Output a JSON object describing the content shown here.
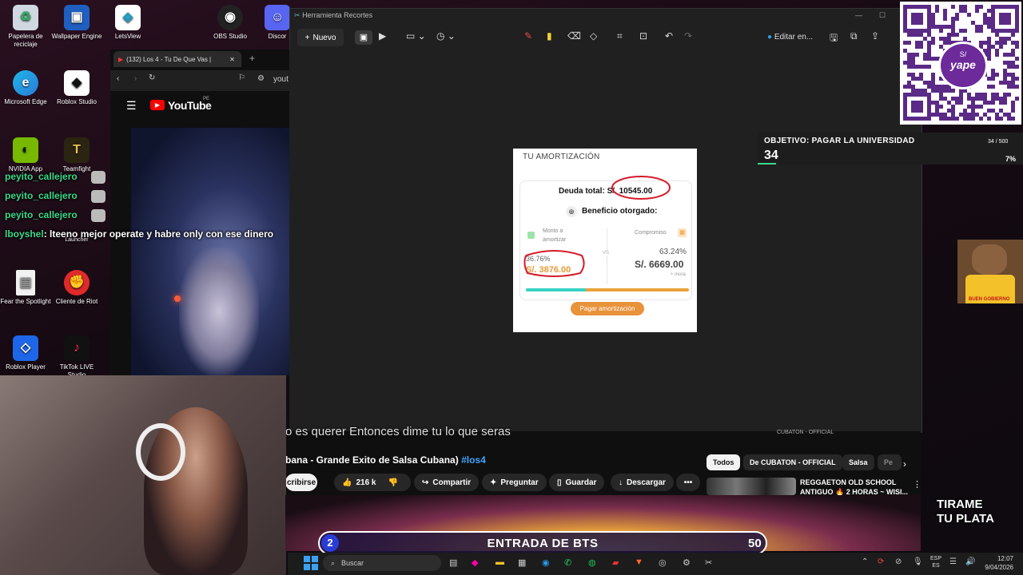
{
  "desktop": {
    "icons": [
      {
        "label": "Papelera de reciclaje",
        "icon": "recycle-bin-icon"
      },
      {
        "label": "Wallpaper Engine",
        "icon": "wallpaper-engine-icon"
      },
      {
        "label": "LetsView",
        "icon": "letsview-icon"
      },
      {
        "label": "OBS Studio",
        "icon": "obs-icon"
      },
      {
        "label": "Discor",
        "icon": "discord-icon"
      },
      {
        "label": "Microsoft Edge",
        "icon": "edge-icon"
      },
      {
        "label": "Roblox Studio",
        "icon": "roblox-studio-icon"
      },
      {
        "label": "NVIDIA App",
        "icon": "nvidia-icon"
      },
      {
        "label": "Teamfight",
        "icon": "teamfight-icon"
      },
      {
        "label": "Launcher",
        "icon": "launcher-icon"
      },
      {
        "label": "Fear the Spotlight",
        "icon": "file-icon"
      },
      {
        "label": "Cliente de Riot",
        "icon": "riot-icon"
      },
      {
        "label": "Roblox Player",
        "icon": "roblox-player-icon"
      },
      {
        "label": "TikTok LIVE Studio",
        "icon": "tiktok-icon"
      }
    ]
  },
  "chat": [
    {
      "user": "peyito_callejero",
      "text": ""
    },
    {
      "user": "peyito_callejero",
      "text": ""
    },
    {
      "user": "peyito_callejero",
      "text": ""
    },
    {
      "user": "lboyshel",
      "text": ": lteeno mejor operate y habre only con ese dinero"
    }
  ],
  "browser": {
    "tab_title": "(132) Los 4 - Tu De Que Vas |",
    "address": "yout",
    "yt_logo": "YouTube",
    "yt_region": "PE"
  },
  "snip": {
    "title": "Herramienta Recortes",
    "new_label": "Nuevo",
    "edit_label": "Editar en..."
  },
  "card": {
    "header": "TU AMORTIZACIÓN",
    "debt_label": "Deuda total:",
    "debt_currency": "S/.",
    "debt_value": "10545.00",
    "benefit": "Beneficio otorgado:",
    "left_label": "Monto a amortizar",
    "left_pct": "36.76%",
    "left_value": "S/. 3876.00",
    "vs": "VS",
    "right_label": "Compromiso",
    "right_pct": "63.24%",
    "right_value": "S/. 6669.00",
    "right_note": "+ mora",
    "progress": 0.3676,
    "button": "Pagar amortización"
  },
  "yt": {
    "caption": "o es querer Entonces dime tu lo que seras",
    "title": "bana - Grande Exito de Salsa Cubana)",
    "hashtag": "#los4",
    "subscribe": "cribirse",
    "likes": "216 k",
    "share": "Compartir",
    "ask": "Preguntar",
    "save": "Guardar",
    "download": "Descargar",
    "chips": [
      "Todos",
      "De CUBATON - OFFICIAL",
      "Salsa",
      "Pe"
    ],
    "rec_channel": "CUBATON - OFFICIAL",
    "rec_title_1": "REGGAETON OLD SCHOOL",
    "rec_title_2": "ANTIGUO 🔥 2 HORAS ~ WISI..."
  },
  "goal": {
    "title": "OBJETIVO: PAGAR LA UNIVERSIDAD",
    "current": "34",
    "count": "34 / 500",
    "pct": "7%",
    "progress": 0.07
  },
  "overlay": {
    "tirame_1": "TIRAME",
    "tirame_2": "TU PLATA",
    "bar_left": "2",
    "bar_text": "ENTRADA DE BTS",
    "bar_right": "50",
    "qr_badge": "S/",
    "qr_brand": "yape",
    "dog_badge": "BUEN GOBIERNO"
  },
  "taskbar": {
    "search": "Buscar",
    "lang_1": "ESP",
    "lang_2": "ES",
    "time": "12:07",
    "date": "9/04/2026"
  }
}
